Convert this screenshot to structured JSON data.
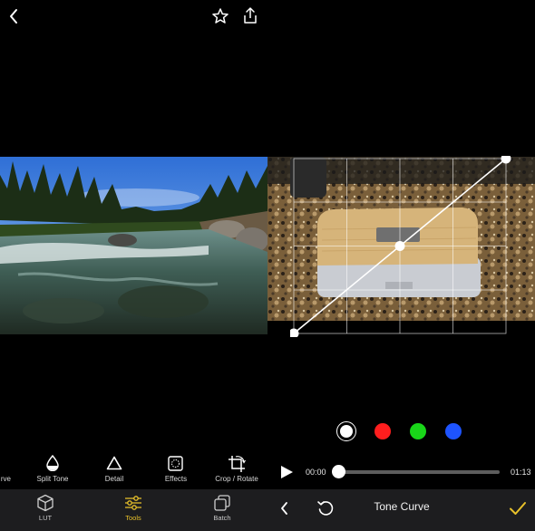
{
  "left": {
    "tools": [
      {
        "label": "rve",
        "icon": "tone-curve-icon"
      },
      {
        "label": "Split Tone",
        "icon": "split-tone-icon"
      },
      {
        "label": "Detail",
        "icon": "detail-triangle-icon"
      },
      {
        "label": "Effects",
        "icon": "effects-icon"
      },
      {
        "label": "Crop / Rotate",
        "icon": "crop-rotate-icon"
      }
    ],
    "tabs": [
      {
        "label": "LUT",
        "icon": "cube-icon"
      },
      {
        "label": "Tools",
        "icon": "sliders-icon",
        "active": true
      },
      {
        "label": "Batch",
        "icon": "batch-icon"
      }
    ],
    "accent": "#e8c12a"
  },
  "right": {
    "channels": [
      {
        "name": "rgb",
        "color": "#ffffff",
        "selected": true
      },
      {
        "name": "red",
        "color": "#ff1e1e"
      },
      {
        "name": "green",
        "color": "#19d619"
      },
      {
        "name": "blue",
        "color": "#1e54ff"
      }
    ],
    "playback": {
      "current": "00:00",
      "total": "01:13",
      "progress": 0.0
    },
    "bottom": {
      "title": "Tone Curve"
    }
  }
}
